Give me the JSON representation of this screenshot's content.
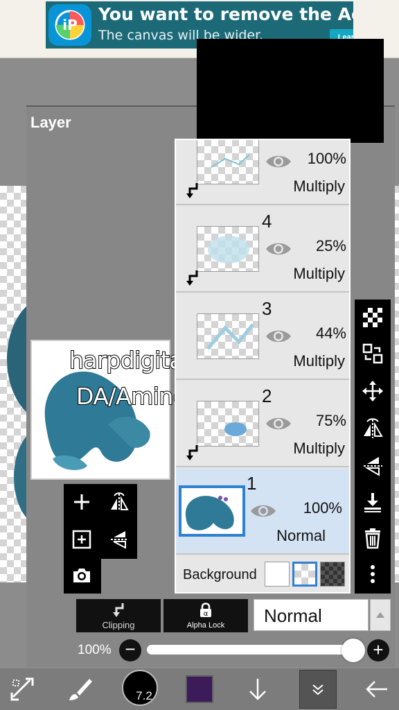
{
  "ad": {
    "title": "You want to remove the Ad?",
    "subtitle": "The canvas will be wider.",
    "cta": "Learn more ▸",
    "logo_icon": "ibispaint-logo-icon"
  },
  "panel": {
    "title": "Layer"
  },
  "watermark": {
    "line1": "harpdigitalart",
    "line2": "DA/Amino/TH"
  },
  "layers": [
    {
      "number": "",
      "opacity": "100%",
      "blend": "Multiply",
      "clipped": true,
      "selected": false
    },
    {
      "number": "4",
      "opacity": "25%",
      "blend": "Multiply",
      "clipped": true,
      "selected": false
    },
    {
      "number": "3",
      "opacity": "44%",
      "blend": "Multiply",
      "clipped": false,
      "selected": false
    },
    {
      "number": "2",
      "opacity": "75%",
      "blend": "Multiply",
      "clipped": true,
      "selected": false
    },
    {
      "number": "1",
      "opacity": "100%",
      "blend": "Normal",
      "clipped": false,
      "selected": true
    }
  ],
  "background": {
    "label": "Background",
    "selected_option": "transparent"
  },
  "controls": {
    "clipping_label": "Clipping",
    "alpha_lock_label": "Alpha Lock",
    "blend_mode": "Normal",
    "opacity_label": "100%",
    "opacity_value": 1.0
  },
  "toolbar": {
    "brush_size": "7.2",
    "current_color": "#3c1b5a"
  },
  "colors": {
    "selection_blue": "#2f7fd3",
    "selected_row": "#d4e3f4",
    "character_teal": "#2f7a97"
  }
}
